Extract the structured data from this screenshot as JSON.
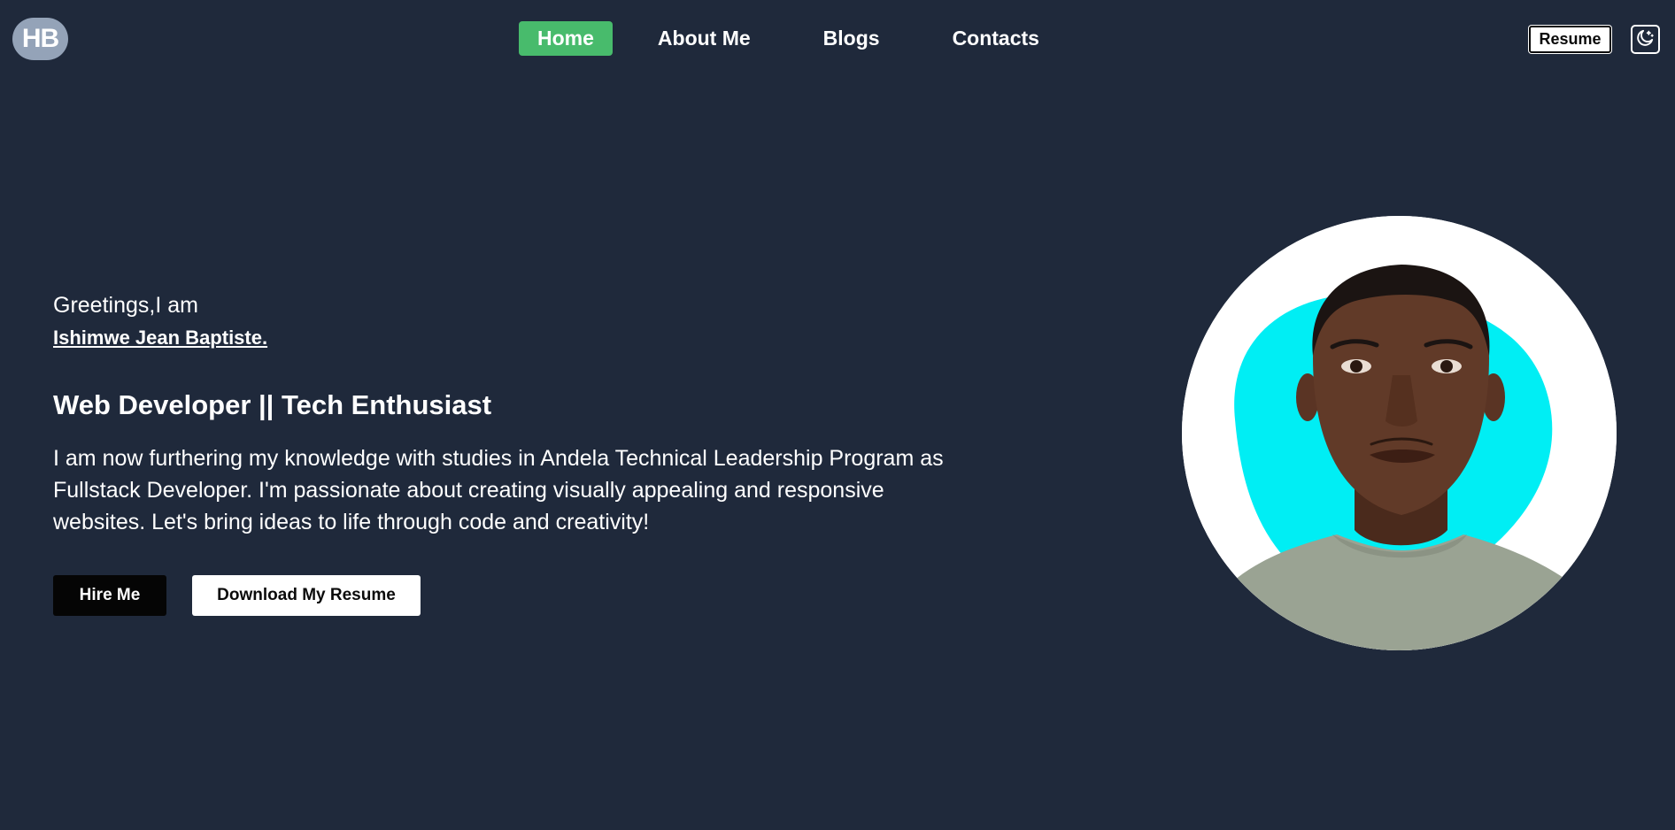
{
  "header": {
    "logo_text": "HB",
    "nav": [
      {
        "label": "Home",
        "active": true
      },
      {
        "label": "About Me",
        "active": false
      },
      {
        "label": "Blogs",
        "active": false
      },
      {
        "label": "Contacts",
        "active": false
      }
    ],
    "resume_label": "Resume",
    "theme_icon": "moon-icon"
  },
  "hero": {
    "greeting": "Greetings,I am",
    "name": "Ishimwe Jean Baptiste.",
    "headline": "Web Developer || Tech Enthusiast",
    "description": "I am now furthering my knowledge with studies in Andela Technical Leadership Program as Fullstack Developer. I'm passionate about creating visually appealing and responsive websites. Let's bring ideas to life through code and creativity!",
    "hire_label": "Hire Me",
    "download_label": "Download My Resume"
  },
  "colors": {
    "background": "#1f293b",
    "accent": "#48bb6c",
    "portrait_blob": "#00eef4"
  }
}
